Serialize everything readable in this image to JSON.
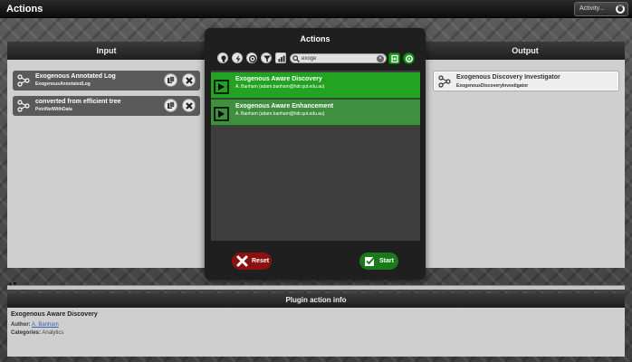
{
  "app": {
    "title": "Actions",
    "activity_label": "Activity..."
  },
  "input_panel": {
    "title": "Input",
    "items": [
      {
        "name": "Exogenous Annotated Log",
        "type": "ExogenousAnnotatedLog"
      },
      {
        "name": "converted from efficient tree",
        "type": "PetriNetWithData"
      }
    ]
  },
  "output_panel": {
    "title": "Output",
    "items": [
      {
        "name": "Exogenous Discovery Investigator",
        "type": "ExogenousDiscoveryInvestigator"
      }
    ]
  },
  "actions_dialog": {
    "title": "Actions",
    "search": {
      "value": "exoge",
      "placeholder": ""
    },
    "actions": [
      {
        "name": "Exogenous Aware Discovery",
        "author": "A. Banham (adam.banham@hdr.qut.edu.au)",
        "selected": true
      },
      {
        "name": "Exogenous Aware Enhancement",
        "author": "A. Banham (adam.banham@hdr.qut.edu.au)",
        "selected": false
      }
    ],
    "reset_label": "Reset",
    "start_label": "Start"
  },
  "plugin_info": {
    "header": "Plugin action info",
    "title": "Exogenous Aware Discovery",
    "author_label": "Author:",
    "author": "A. Banham",
    "categories_label": "Categories:",
    "categories": "Analytics"
  },
  "colors": {
    "accent_green": "#1f9a1f",
    "selected_green": "#22a322",
    "reset_red": "#8b1010",
    "header_dark": "#2a2a2a"
  },
  "icons": [
    "lightbulb-icon",
    "lightning-icon",
    "plugin-icon",
    "filter-icon",
    "chart-icon",
    "search-icon",
    "clear-icon",
    "import-icon",
    "refresh-icon",
    "petri-net-icon",
    "copy-icon",
    "remove-icon",
    "play-icon",
    "reset-x-icon",
    "checkbox-icon"
  ]
}
